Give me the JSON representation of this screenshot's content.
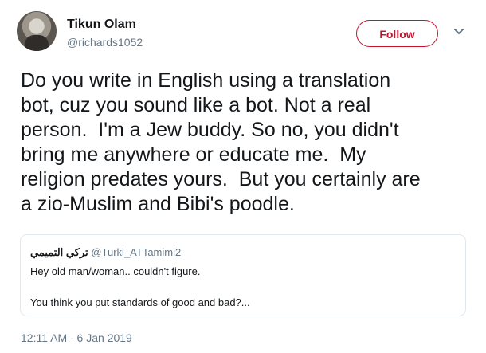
{
  "user": {
    "display_name": "Tikun Olam",
    "handle": "@richards1052"
  },
  "actions": {
    "follow_label": "Follow",
    "chevron_icon": "chevron-down-icon"
  },
  "tweet": {
    "text": "Do you write in English using a translation\nbot, cuz you sound like a bot. Not a real\nperson.  I'm a Jew buddy. So no, you didn't\nbring me anywhere or educate me.  My\nreligion predates yours.  But you certainly are\na zio-Muslim and Bibi's poodle.",
    "timestamp": "12:11 AM - 6 Jan 2019"
  },
  "quoted_tweet": {
    "author_name": "تركي التميمي",
    "author_handle": "@Turki_ATTamimi2",
    "line1": "Hey old man/woman.. couldn't figure.",
    "line2": "You think you put standards of good and bad?..."
  },
  "colors": {
    "follow_accent": "#c5122d",
    "secondary_text": "#657786",
    "border": "#e1e8ed"
  }
}
